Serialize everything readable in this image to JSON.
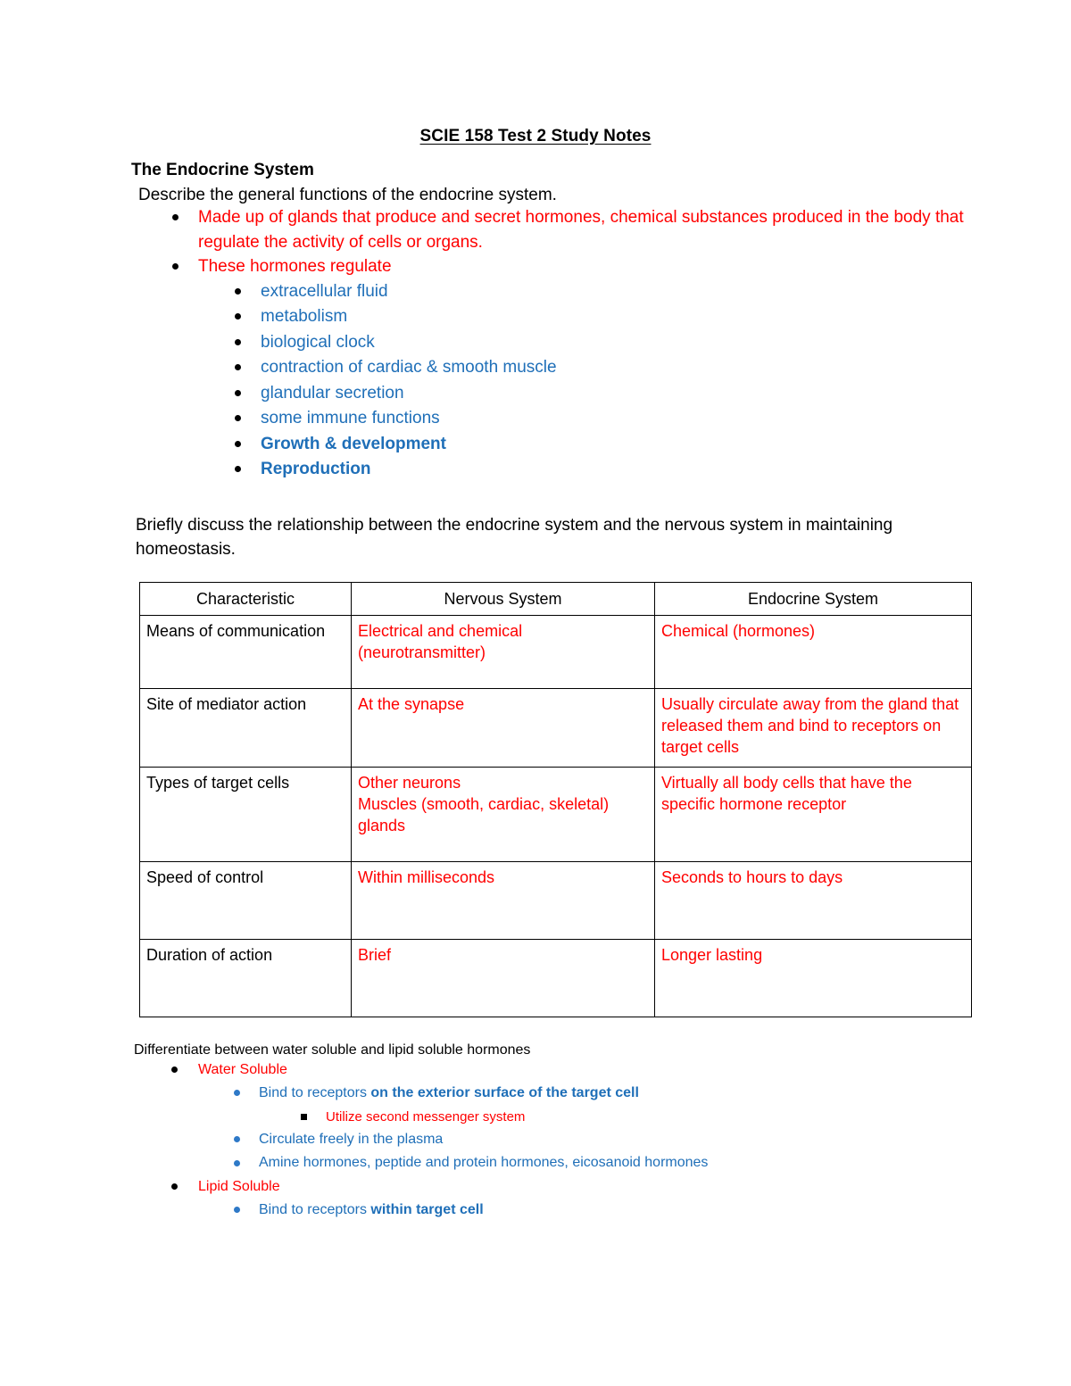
{
  "document": {
    "title": "SCIE 158 Test 2 Study Notes",
    "section_heading": "The Endocrine System",
    "prompt_1": "Describe the general functions of the endocrine system.",
    "bullets": [
      {
        "text": "Made up of glands that produce and secret hormones, chemical substances produced in the body that regulate the activity of cells or organs."
      },
      {
        "text": "These hormones regulate"
      }
    ],
    "sub_bullets": [
      {
        "text": "extracellular fluid",
        "bold": false
      },
      {
        "text": "metabolism",
        "bold": false
      },
      {
        "text": "biological clock",
        "bold": false
      },
      {
        "text": "contraction of cardiac & smooth muscle",
        "bold": false
      },
      {
        "text": "glandular secretion",
        "bold": false
      },
      {
        "text": "some immune functions",
        "bold": false
      },
      {
        "text": "Growth & development",
        "bold": true
      },
      {
        "text": "Reproduction",
        "bold": true
      }
    ],
    "paragraph_1": "Briefly discuss the relationship between the endocrine system and the nervous system in maintaining homeostasis.",
    "prompt_2": "Differentiate between water soluble and lipid soluble hormones"
  },
  "table": {
    "headers": [
      "Characteristic",
      "Nervous System",
      "Endocrine System"
    ],
    "rows": [
      {
        "characteristic": "Means of communication",
        "nervous": "Electrical and chemical (neurotransmitter)",
        "endocrine": "Chemical (hormones)"
      },
      {
        "characteristic": "Site of mediator action",
        "nervous": "At the synapse",
        "endocrine": "Usually circulate away from the gland that released them and bind to receptors on target cells"
      },
      {
        "characteristic": "Types of target cells",
        "nervous": "Other neurons\nMuscles (smooth, cardiac, skeletal) glands",
        "endocrine": "Virtually all body cells that have the specific hormone receptor"
      },
      {
        "characteristic": "Speed of control",
        "nervous": "Within milliseconds",
        "endocrine": "Seconds to hours to days"
      },
      {
        "characteristic": "Duration of action",
        "nervous": "Brief",
        "endocrine": "Longer lasting"
      }
    ]
  },
  "solubility": {
    "water_soluble_label": "Water Soluble",
    "water_items": [
      {
        "normal": "Bind to receptors ",
        "bold": "on the exterior surface of the target cell"
      },
      {
        "normal": "Circulate freely in the plasma",
        "bold": ""
      },
      {
        "normal": "Amine hormones, peptide and protein hormones, eicosanoid hormones",
        "bold": ""
      }
    ],
    "water_sub_item": "Utilize second messenger system",
    "lipid_soluble_label": "Lipid Soluble",
    "lipid_items": [
      {
        "normal": "Bind to receptors ",
        "bold": "within target cell"
      }
    ]
  },
  "colors": {
    "red": "#FF0000",
    "blue": "#1F6FB8",
    "black": "#000000",
    "bullet_blue": "#2E79C7"
  }
}
